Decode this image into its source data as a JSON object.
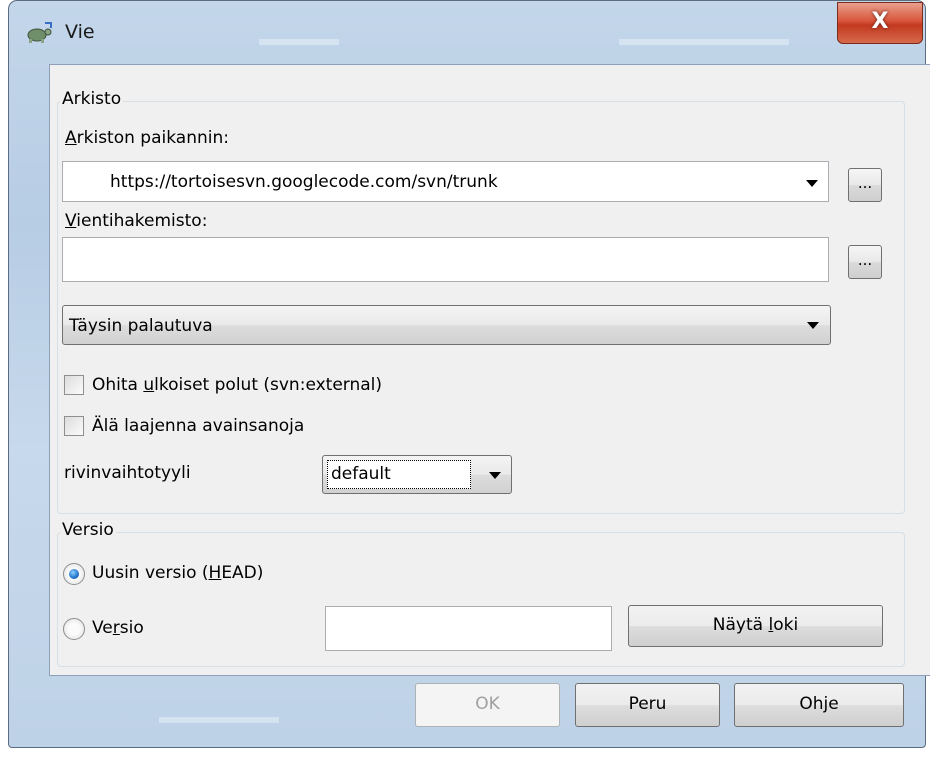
{
  "window": {
    "title": "Vie",
    "close_label": "X"
  },
  "repository_group": {
    "title": "Arkisto",
    "url_label_accel": "A",
    "url_label_rest": "rkiston paikannin:",
    "url_value": "https://tortoisesvn.googlecode.com/svn/trunk",
    "browse_label": "...",
    "export_dir_label_accel": "V",
    "export_dir_label_rest": "ientihakemisto:",
    "export_dir_value": "",
    "depth_value": "Täysin palautuva",
    "omit_externals_pre": "Ohita ",
    "omit_externals_accel": "u",
    "omit_externals_post": "lkoiset polut (svn:external)",
    "omit_externals_checked": false,
    "no_keywords_label": "Älä laajenna avainsanoja",
    "no_keywords_checked": false,
    "eol_label": "rivinvaihtotyyli",
    "eol_value": "default"
  },
  "revision_group": {
    "title": "Versio",
    "head_pre": "Uusin versio (",
    "head_accel": "H",
    "head_post": "EAD)",
    "head_selected": true,
    "rev_pre": "Ve",
    "rev_accel": "r",
    "rev_post": "sio",
    "rev_selected": false,
    "rev_value": "",
    "show_log_pre": "Näytä ",
    "show_log_accel": "l",
    "show_log_post": "oki"
  },
  "buttons": {
    "ok": "OK",
    "cancel": "Peru",
    "help": "Ohje"
  }
}
